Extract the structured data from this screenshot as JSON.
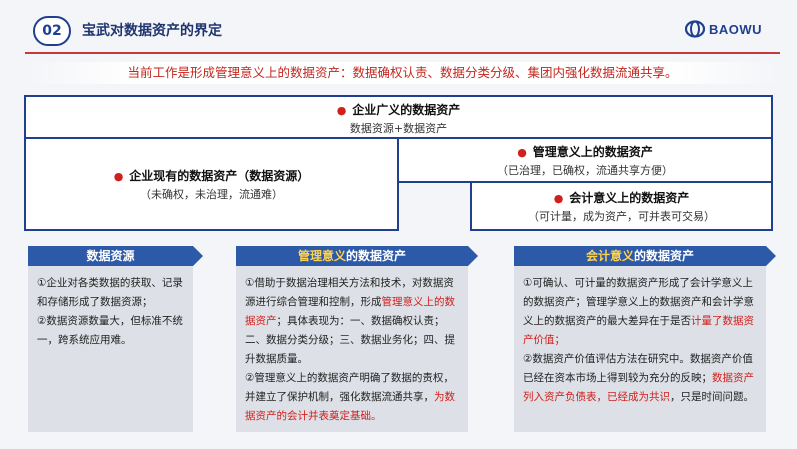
{
  "header": {
    "number": "02",
    "title": "宝武对数据资产的界定",
    "logo_text": "BAOWU"
  },
  "intro": "当前工作是形成管理意义上的数据资产：数据确权认责、数据分类分级、集团内强化数据流通共享。",
  "framework": {
    "top": {
      "title": "企业广义的数据资产",
      "sub": "数据资源+数据资产"
    },
    "left": {
      "title": "企业现有的数据资产（数据资源）",
      "sub": "（未确权，未治理，流通难）"
    },
    "mid": {
      "title": "管理意义上的数据资产",
      "sub": "（已治理，已确权，流通共享方便）"
    },
    "bottom_right": {
      "title": "会计意义上的数据资产",
      "sub": "（可计量，成为资产，可并表可交易）"
    }
  },
  "panels": {
    "p1": {
      "title": "数据资源",
      "text1": "①企业对各类数据的获取、记录和存储形成了数据资源；",
      "text2": "②数据资源数量大，但标准不统一，跨系统应用难。"
    },
    "p2": {
      "title_red": "管理意义",
      "title_rest": "的数据资产",
      "t1": "①借助于数据治理相关方法和技术，对数据资源进行综合管理和控制，形成",
      "t1_red": "管理意义上的数据资产",
      "t1_rest": "；具体表现为：一、数据确权认责；二、数据分类分级；三、数据业务化；四、提升数据质量。",
      "t2": "②管理意义上的数据资产明确了数据的责权，并建立了保护机制，强化数据流通共享，",
      "t2_red": "为数据资产的会计并表奠定基础。"
    },
    "p3": {
      "title_red": "会计意义",
      "title_rest": "的数据资产",
      "t1": "①可确认、可计量的数据资产形成了会计学意义上的数据资产；管理学意义上的数据资产和会计学意义上的数据资产的最大差异在于是否",
      "t1_red": "计量了数据资产价值；",
      "t2": "②数据资产价值评估方法在研究中。数据资产价值已经在资本市场上得到较为充分的反映；",
      "t2_red": "数据资产列入资产负债表，已经成为共识",
      "t2_rest": "，只是时间问题。"
    }
  },
  "colors": {
    "brand": "#1f3f8f",
    "accent": "#d0201c",
    "panel_head": "#2d5aa8"
  }
}
